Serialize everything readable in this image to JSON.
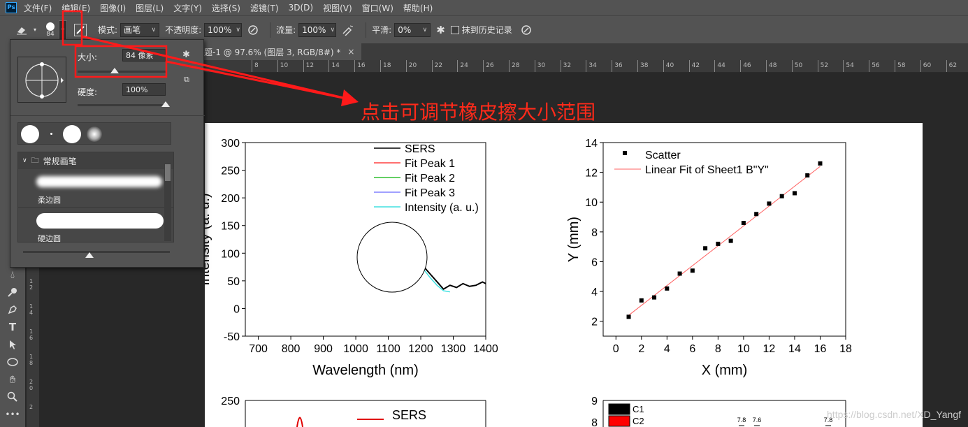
{
  "menubar": {
    "logo": "Ps",
    "items": [
      "文件(F)",
      "编辑(E)",
      "图像(I)",
      "图层(L)",
      "文字(Y)",
      "选择(S)",
      "滤镜(T)",
      "3D(D)",
      "视图(V)",
      "窗口(W)",
      "帮助(H)"
    ]
  },
  "options": {
    "brush_size": "84",
    "mode_label": "模式:",
    "mode_value": "画笔",
    "opacity_label": "不透明度:",
    "opacity_value": "100%",
    "flow_label": "流量:",
    "flow_value": "100%",
    "smooth_label": "平滑:",
    "smooth_value": "0%",
    "erase_history_label": "抹到历史记录"
  },
  "document_tab": {
    "title": "题-1 @ 97.6% (图层 3, RGB/8#) *",
    "close": "×"
  },
  "ruler": {
    "h_ticks": [
      "8",
      "10",
      "12",
      "14",
      "16",
      "18",
      "20",
      "22",
      "24",
      "26",
      "28",
      "30",
      "32",
      "34",
      "36",
      "38",
      "40",
      "42",
      "44",
      "46",
      "48",
      "50",
      "52",
      "54",
      "56",
      "58",
      "60",
      "62"
    ],
    "v_ticks": [
      "1",
      "2",
      "1",
      "4",
      "1",
      "6",
      "1",
      "8",
      "2",
      "0",
      "2"
    ]
  },
  "brush_panel": {
    "size_label": "大小:",
    "size_value": "84 像素",
    "size_fraction": 0.42,
    "hardness_label": "硬度:",
    "hardness_value": "100%",
    "hardness_fraction": 1.0,
    "folder_label": "常规画笔",
    "presets": [
      {
        "label": "柔边圆"
      },
      {
        "label": "硬边圆"
      }
    ],
    "scroll_fraction": 0.45
  },
  "annotation": {
    "text": "点击可调节橡皮擦大小范围",
    "color": "#ff2a1a"
  },
  "colors": {
    "accent_red": "#ff1a1a",
    "ui_bg": "#535353",
    "canvas_bg": "#282828"
  },
  "watermark": "https://blog.csdn.net/XD_Yangf",
  "chart_data": [
    {
      "type": "line",
      "xlabel": "Wavelength (nm)",
      "ylabel": "Intensity (a. u.)",
      "xlim": [
        660,
        1400
      ],
      "ylim": [
        -50,
        300
      ],
      "xticks": [
        700,
        800,
        900,
        1000,
        1100,
        1200,
        1300,
        1400
      ],
      "yticks": [
        -50,
        0,
        50,
        100,
        150,
        200,
        250,
        300
      ],
      "legend": [
        "SERS",
        "Fit Peak 1",
        "Fit Peak 2",
        "Fit Peak 3",
        "Intensity (a. u.)"
      ],
      "legend_colors": [
        "#000000",
        "#ff4040",
        "#30c030",
        "#8080ff",
        "#40e0e0"
      ],
      "legend_position": "top-right",
      "series": [
        {
          "name": "SERS",
          "x": [
            1210,
            1225,
            1240,
            1255,
            1270,
            1290,
            1310,
            1330,
            1350,
            1370,
            1390,
            1400
          ],
          "y": [
            75,
            65,
            55,
            45,
            35,
            42,
            38,
            45,
            40,
            42,
            48,
            45
          ]
        },
        {
          "name": "Intensity (a. u.)",
          "x": [
            1210,
            1230,
            1250,
            1270,
            1290
          ],
          "y": [
            70,
            55,
            42,
            32,
            30
          ]
        }
      ]
    },
    {
      "type": "scatter",
      "xlabel": "X (mm)",
      "ylabel": "Y (mm)",
      "xlim": [
        -1,
        18
      ],
      "ylim": [
        1,
        14
      ],
      "xticks": [
        0,
        2,
        4,
        6,
        8,
        10,
        12,
        14,
        16,
        18
      ],
      "yticks": [
        2,
        4,
        6,
        8,
        10,
        12,
        14
      ],
      "legend": [
        "Scatter",
        "Linear Fit of Sheet1 B\"Y\""
      ],
      "legend_position": "top-left",
      "series": [
        {
          "name": "Scatter",
          "x": [
            1,
            2,
            3,
            4,
            5,
            6,
            7,
            8,
            9,
            10,
            11,
            12,
            13,
            14,
            15,
            16
          ],
          "y": [
            2.3,
            3.4,
            3.6,
            4.2,
            5.2,
            5.4,
            6.9,
            7.2,
            7.4,
            8.6,
            9.2,
            9.9,
            10.4,
            10.6,
            11.8,
            12.6
          ]
        },
        {
          "name": "Linear Fit of Sheet1 B\"Y\"",
          "x": [
            1,
            16
          ],
          "y": [
            2.4,
            12.4
          ]
        }
      ]
    },
    {
      "type": "line",
      "yticks": [
        250
      ],
      "legend": [
        "SERS"
      ],
      "legend_position": "top-right"
    },
    {
      "type": "bar",
      "yticks": [
        8,
        9
      ],
      "legend": [
        "C1",
        "C2"
      ],
      "legend_colors": [
        "#000000",
        "#ff0000"
      ],
      "legend_position": "top-left",
      "annotations": [
        "7.8",
        "7.6",
        "7.8"
      ]
    }
  ]
}
